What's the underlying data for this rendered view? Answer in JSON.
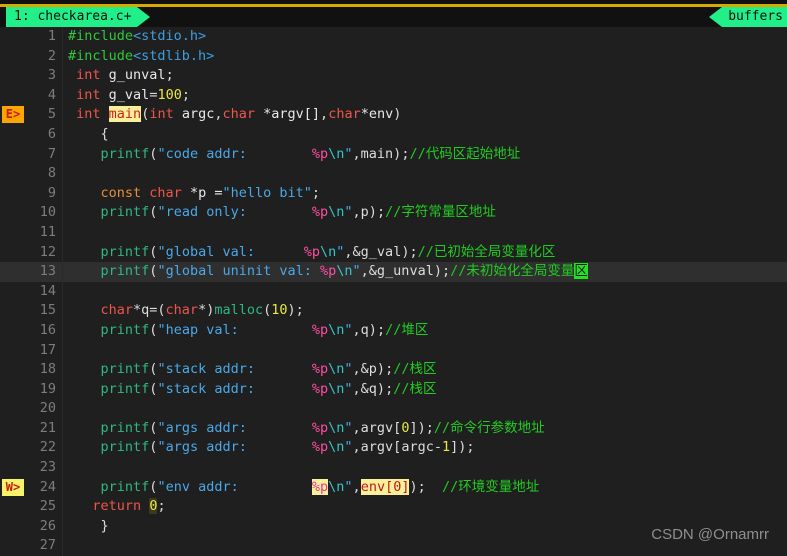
{
  "window": {
    "accent_green": "#21f08a",
    "accent_gold": "#d8a900",
    "background": "#1f1f1f"
  },
  "tabs": {
    "active_tab": "1: checkarea.c+",
    "buffers_tab": "buffers"
  },
  "watermark": "CSDN @Ornamrr",
  "gutter": {
    "error_marker": "E>",
    "warning_marker": "W>",
    "error_line": 5,
    "warning_line": 24
  },
  "editor": {
    "cursor_line": 13,
    "lines": [
      {
        "n": "1",
        "tokens": [
          {
            "t": "#include",
            "c": "pp"
          },
          {
            "t": "<stdio.h>",
            "c": "hdr"
          }
        ]
      },
      {
        "n": "2",
        "tokens": [
          {
            "t": "#include",
            "c": "pp"
          },
          {
            "t": "<stdlib.h>",
            "c": "hdr"
          }
        ]
      },
      {
        "n": "3",
        "tokens": [
          {
            "t": " ",
            "c": "id"
          },
          {
            "t": "int",
            "c": "kw"
          },
          {
            "t": " g_unval",
            "c": "id"
          },
          {
            "t": ";",
            "c": "pun"
          }
        ]
      },
      {
        "n": "4",
        "tokens": [
          {
            "t": " ",
            "c": "id"
          },
          {
            "t": "int",
            "c": "kw"
          },
          {
            "t": " g_val",
            "c": "id"
          },
          {
            "t": "=",
            "c": "pun"
          },
          {
            "t": "100",
            "c": "num"
          },
          {
            "t": ";",
            "c": "pun"
          }
        ]
      },
      {
        "n": "5",
        "tokens": [
          {
            "t": " ",
            "c": "id"
          },
          {
            "t": "int",
            "c": "kw"
          },
          {
            "t": " ",
            "c": "id"
          },
          {
            "t": "main",
            "c": "hl-main"
          },
          {
            "t": "(",
            "c": "pun"
          },
          {
            "t": "int",
            "c": "kw"
          },
          {
            "t": " argc",
            "c": "id"
          },
          {
            "t": ",",
            "c": "pun"
          },
          {
            "t": "char",
            "c": "kw"
          },
          {
            "t": " *argv[]",
            "c": "id"
          },
          {
            "t": ",",
            "c": "pun"
          },
          {
            "t": "char",
            "c": "kw"
          },
          {
            "t": "*env",
            "c": "id"
          },
          {
            "t": ")",
            "c": "pun"
          }
        ]
      },
      {
        "n": "6",
        "tokens": [
          {
            "t": "    ",
            "c": "id"
          },
          {
            "t": "{",
            "c": "pun"
          }
        ]
      },
      {
        "n": "7",
        "tokens": [
          {
            "t": "    ",
            "c": "id"
          },
          {
            "t": "printf",
            "c": "fn"
          },
          {
            "t": "(",
            "c": "pun"
          },
          {
            "t": "\"code addr:        ",
            "c": "str"
          },
          {
            "t": "%p",
            "c": "fmt"
          },
          {
            "t": "\\n",
            "c": "esc"
          },
          {
            "t": "\"",
            "c": "str"
          },
          {
            "t": ",main)",
            "c": "pun"
          },
          {
            "t": ";",
            "c": "pun"
          },
          {
            "t": "//代码区起始地址",
            "c": "cmt"
          }
        ]
      },
      {
        "n": "8",
        "tokens": []
      },
      {
        "n": "9",
        "tokens": [
          {
            "t": "    ",
            "c": "id"
          },
          {
            "t": "const",
            "c": "kw2"
          },
          {
            "t": " ",
            "c": "id"
          },
          {
            "t": "char",
            "c": "kw"
          },
          {
            "t": " *p =",
            "c": "id"
          },
          {
            "t": "\"hello bit\"",
            "c": "str"
          },
          {
            "t": ";",
            "c": "pun"
          }
        ]
      },
      {
        "n": "10",
        "tokens": [
          {
            "t": "    ",
            "c": "id"
          },
          {
            "t": "printf",
            "c": "fn"
          },
          {
            "t": "(",
            "c": "pun"
          },
          {
            "t": "\"read only:        ",
            "c": "str"
          },
          {
            "t": "%p",
            "c": "fmt"
          },
          {
            "t": "\\n",
            "c": "esc"
          },
          {
            "t": "\"",
            "c": "str"
          },
          {
            "t": ",p)",
            "c": "pun"
          },
          {
            "t": ";",
            "c": "pun"
          },
          {
            "t": "//字符常量区地址",
            "c": "cmt"
          }
        ]
      },
      {
        "n": "11",
        "tokens": []
      },
      {
        "n": "12",
        "tokens": [
          {
            "t": "    ",
            "c": "id"
          },
          {
            "t": "printf",
            "c": "fn"
          },
          {
            "t": "(",
            "c": "pun"
          },
          {
            "t": "\"global val:      ",
            "c": "str"
          },
          {
            "t": "%p",
            "c": "fmt"
          },
          {
            "t": "\\n",
            "c": "esc"
          },
          {
            "t": "\"",
            "c": "str"
          },
          {
            "t": ",&g_val)",
            "c": "pun"
          },
          {
            "t": ";",
            "c": "pun"
          },
          {
            "t": "//已初始全局变量化区",
            "c": "cmt"
          }
        ]
      },
      {
        "n": "13",
        "tokens": [
          {
            "t": "    ",
            "c": "id"
          },
          {
            "t": "printf",
            "c": "fn"
          },
          {
            "t": "(",
            "c": "pun"
          },
          {
            "t": "\"global uninit val: ",
            "c": "str"
          },
          {
            "t": "%p",
            "c": "fmt"
          },
          {
            "t": "\\n",
            "c": "esc"
          },
          {
            "t": "\"",
            "c": "str"
          },
          {
            "t": ",&g_unval)",
            "c": "pun"
          },
          {
            "t": ";",
            "c": "pun"
          },
          {
            "t": "//未初始化全局变量",
            "c": "cmt"
          },
          {
            "t": "区",
            "c": "cursor"
          }
        ]
      },
      {
        "n": "14",
        "tokens": []
      },
      {
        "n": "15",
        "tokens": [
          {
            "t": "    ",
            "c": "id"
          },
          {
            "t": "char",
            "c": "kw"
          },
          {
            "t": "*q=(",
            "c": "pun"
          },
          {
            "t": "char",
            "c": "kw"
          },
          {
            "t": "*)",
            "c": "pun"
          },
          {
            "t": "malloc",
            "c": "fn"
          },
          {
            "t": "(",
            "c": "pun"
          },
          {
            "t": "10",
            "c": "num"
          },
          {
            "t": ")",
            "c": "pun"
          },
          {
            "t": ";",
            "c": "pun"
          }
        ]
      },
      {
        "n": "16",
        "tokens": [
          {
            "t": "    ",
            "c": "id"
          },
          {
            "t": "printf",
            "c": "fn"
          },
          {
            "t": "(",
            "c": "pun"
          },
          {
            "t": "\"heap val:         ",
            "c": "str"
          },
          {
            "t": "%p",
            "c": "fmt"
          },
          {
            "t": "\\n",
            "c": "esc"
          },
          {
            "t": "\"",
            "c": "str"
          },
          {
            "t": ",q)",
            "c": "pun"
          },
          {
            "t": ";",
            "c": "pun"
          },
          {
            "t": "//堆区",
            "c": "cmt"
          }
        ]
      },
      {
        "n": "17",
        "tokens": []
      },
      {
        "n": "18",
        "tokens": [
          {
            "t": "    ",
            "c": "id"
          },
          {
            "t": "printf",
            "c": "fn"
          },
          {
            "t": "(",
            "c": "pun"
          },
          {
            "t": "\"stack addr:       ",
            "c": "str"
          },
          {
            "t": "%p",
            "c": "fmt"
          },
          {
            "t": "\\n",
            "c": "esc"
          },
          {
            "t": "\"",
            "c": "str"
          },
          {
            "t": ",&p)",
            "c": "pun"
          },
          {
            "t": ";",
            "c": "pun"
          },
          {
            "t": "//栈区",
            "c": "cmt"
          }
        ]
      },
      {
        "n": "19",
        "tokens": [
          {
            "t": "    ",
            "c": "id"
          },
          {
            "t": "printf",
            "c": "fn"
          },
          {
            "t": "(",
            "c": "pun"
          },
          {
            "t": "\"stack addr:       ",
            "c": "str"
          },
          {
            "t": "%p",
            "c": "fmt"
          },
          {
            "t": "\\n",
            "c": "esc"
          },
          {
            "t": "\"",
            "c": "str"
          },
          {
            "t": ",&q)",
            "c": "pun"
          },
          {
            "t": ";",
            "c": "pun"
          },
          {
            "t": "//栈区",
            "c": "cmt"
          }
        ]
      },
      {
        "n": "20",
        "tokens": []
      },
      {
        "n": "21",
        "tokens": [
          {
            "t": "    ",
            "c": "id"
          },
          {
            "t": "printf",
            "c": "fn"
          },
          {
            "t": "(",
            "c": "pun"
          },
          {
            "t": "\"args addr:        ",
            "c": "str"
          },
          {
            "t": "%p",
            "c": "fmt"
          },
          {
            "t": "\\n",
            "c": "esc"
          },
          {
            "t": "\"",
            "c": "str"
          },
          {
            "t": ",argv[",
            "c": "pun"
          },
          {
            "t": "0",
            "c": "num"
          },
          {
            "t": "])",
            "c": "pun"
          },
          {
            "t": ";",
            "c": "pun"
          },
          {
            "t": "//命令行参数地址",
            "c": "cmt"
          }
        ]
      },
      {
        "n": "22",
        "tokens": [
          {
            "t": "    ",
            "c": "id"
          },
          {
            "t": "printf",
            "c": "fn"
          },
          {
            "t": "(",
            "c": "pun"
          },
          {
            "t": "\"args addr:        ",
            "c": "str"
          },
          {
            "t": "%p",
            "c": "fmt"
          },
          {
            "t": "\\n",
            "c": "esc"
          },
          {
            "t": "\"",
            "c": "str"
          },
          {
            "t": ",argv[argc-",
            "c": "pun"
          },
          {
            "t": "1",
            "c": "num"
          },
          {
            "t": "])",
            "c": "pun"
          },
          {
            "t": ";",
            "c": "pun"
          }
        ]
      },
      {
        "n": "23",
        "tokens": []
      },
      {
        "n": "24",
        "tokens": [
          {
            "t": "    ",
            "c": "id"
          },
          {
            "t": "printf",
            "c": "fn"
          },
          {
            "t": "(",
            "c": "pun"
          },
          {
            "t": "\"env addr:         ",
            "c": "str"
          },
          {
            "t": "%p",
            "c": "hl-y fmt"
          },
          {
            "t": "\\n",
            "c": "esc"
          },
          {
            "t": "\"",
            "c": "str"
          },
          {
            "t": ",",
            "c": "pun"
          },
          {
            "t": "env[0]",
            "c": "hl-y id"
          },
          {
            "t": ")",
            "c": "pun"
          },
          {
            "t": ";",
            "c": "pun"
          },
          {
            "t": "  ",
            "c": "id"
          },
          {
            "t": "//环境变量地址",
            "c": "cmt"
          }
        ]
      },
      {
        "n": "25",
        "tokens": [
          {
            "t": "   ",
            "c": "id"
          },
          {
            "t": "return",
            "c": "kw"
          },
          {
            "t": " ",
            "c": "id"
          },
          {
            "t": "0",
            "c": "hl-num"
          },
          {
            "t": ";",
            "c": "pun"
          }
        ]
      },
      {
        "n": "26",
        "tokens": [
          {
            "t": "    ",
            "c": "id"
          },
          {
            "t": "}",
            "c": "pun"
          }
        ]
      },
      {
        "n": "27",
        "tokens": []
      }
    ]
  }
}
